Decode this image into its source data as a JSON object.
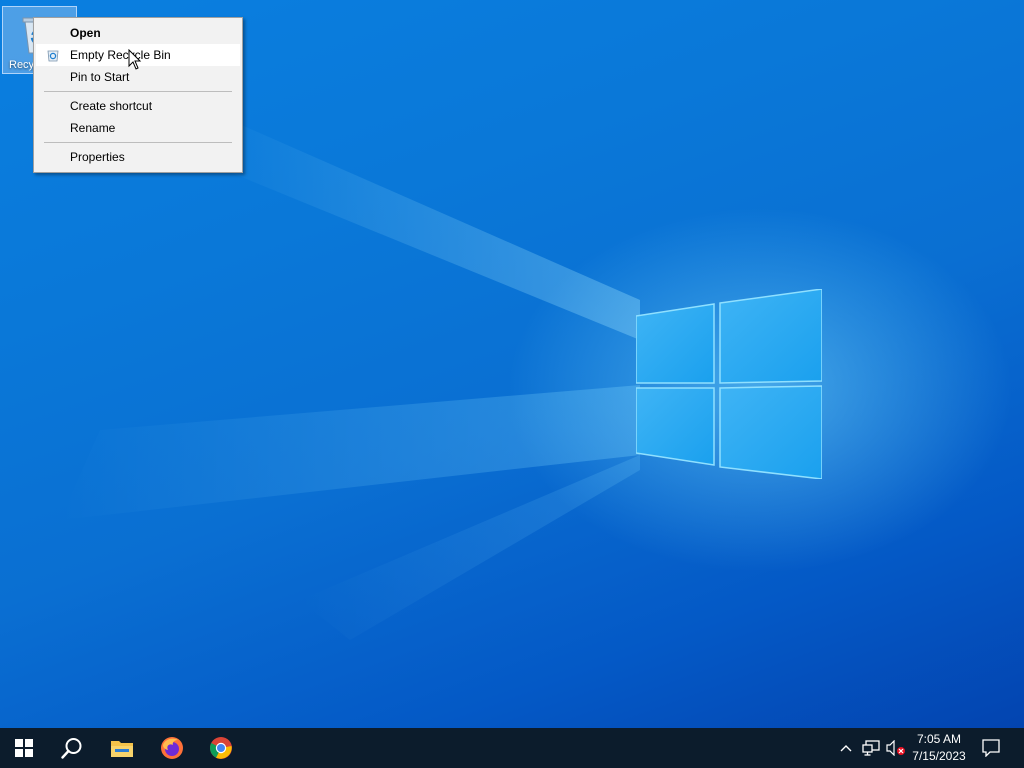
{
  "desktop": {
    "icons": [
      {
        "name": "recycle-bin",
        "label": "Recycle Bin",
        "visible_label": "Recy"
      }
    ]
  },
  "context_menu": {
    "items": [
      {
        "label": "Open",
        "bold": true
      },
      {
        "label": "Empty Recycle Bin",
        "icon": "recycle-bin-icon",
        "highlighted": true
      },
      {
        "label": "Pin to Start"
      },
      {
        "label": "Create shortcut"
      },
      {
        "label": "Rename"
      },
      {
        "label": "Properties"
      }
    ]
  },
  "taskbar": {
    "start": {
      "icon": "windows-start-icon"
    },
    "search": {
      "icon": "search-icon"
    },
    "pinned": [
      {
        "name": "file-explorer",
        "icon": "folder-icon"
      },
      {
        "name": "firefox",
        "icon": "firefox-icon"
      },
      {
        "name": "chrome",
        "icon": "chrome-icon"
      }
    ],
    "tray": {
      "icons": [
        "chevron-up-icon",
        "network-icon",
        "volume-muted-icon"
      ],
      "time": "7:05 AM",
      "date": "7/15/2023",
      "notification_icon": "notification-icon"
    }
  },
  "colors": {
    "desktop_blue": "#0a78d8",
    "taskbar": "#0c1c2c",
    "menu_bg": "#f2f2f2",
    "menu_hover": "#ffffff"
  }
}
